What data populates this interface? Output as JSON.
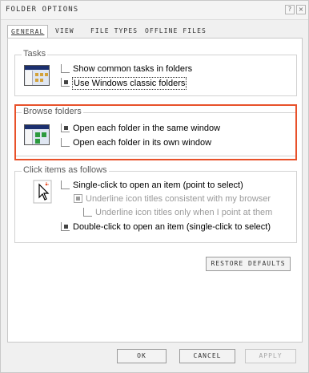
{
  "window": {
    "title": "FOLDER OPTIONS",
    "help_glyph": "?",
    "close_glyph": "×"
  },
  "tabs": [
    {
      "label": "GENERAL",
      "active": true
    },
    {
      "label": "VIEW",
      "active": false
    },
    {
      "label": "FILE TYPES",
      "active": false
    },
    {
      "label": "OFFLINE FILES",
      "active": false
    }
  ],
  "tasks": {
    "label": "Tasks",
    "options": [
      {
        "label": "Show common tasks in folders",
        "checked": false
      },
      {
        "label": "Use Windows classic folders",
        "checked": true
      }
    ]
  },
  "browse": {
    "label": "Browse folders",
    "options": [
      {
        "label": "Open each folder in the same window",
        "checked": true
      },
      {
        "label": "Open each folder in its own window",
        "checked": false
      }
    ]
  },
  "click_items": {
    "label": "Click items as follows",
    "options": [
      {
        "label": "Single-click to open an item (point to select)",
        "checked": false,
        "enabled": true
      },
      {
        "label": "Underline icon titles consistent with my browser",
        "checked": true,
        "enabled": false
      },
      {
        "label": "Underline icon titles only when I point at them",
        "checked": false,
        "enabled": false
      },
      {
        "label": "Double-click to open an item (single-click to select)",
        "checked": true,
        "enabled": true
      }
    ]
  },
  "buttons": {
    "restore": "RESTORE DEFAULTS",
    "ok": "OK",
    "cancel": "CANCEL",
    "apply": "APPLY"
  },
  "colors": {
    "highlight": "#e8512a",
    "thumb_titlebar": "#1b2f6e"
  }
}
